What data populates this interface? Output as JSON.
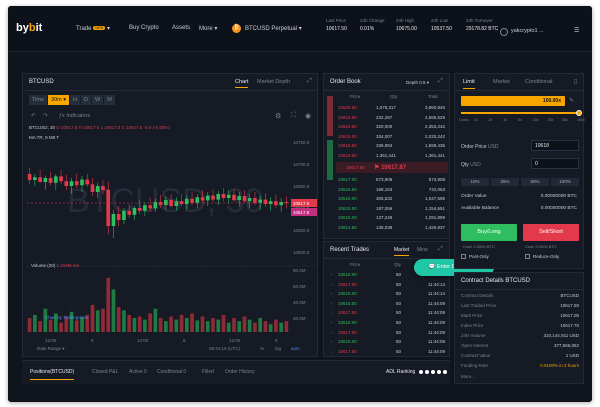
{
  "topbar": {
    "logo_prefix": "by",
    "logo_mid": "b",
    "logo_suffix": "it",
    "nav": [
      {
        "label": "Trade",
        "badge": "NEW"
      },
      {
        "label": "Buy Crypto"
      },
      {
        "label": "Assets"
      },
      {
        "label": "More"
      }
    ],
    "symbol": "BTCUSD Perpetual",
    "stats": [
      {
        "label": "Last Price",
        "value": "10617.50"
      },
      {
        "label": "24h Change",
        "value": "0.01%"
      },
      {
        "label": "24h High",
        "value": "10675.00"
      },
      {
        "label": "24h Low",
        "value": "10537.50"
      },
      {
        "label": "24h Turnover",
        "value": "29178.82 BTC"
      }
    ],
    "deposit": "Deposit",
    "username": "yakcrypto1 ..."
  },
  "chart_panel": {
    "title": "BTCUSD",
    "tab_chart": "Chart",
    "tab_depth": "Market Depth",
    "timeframes": [
      "Time",
      "30m",
      "H",
      "D",
      "W",
      "M"
    ],
    "indicators": "Indicators",
    "ohlc_label": "BTCUSD, 30",
    "ohlc_values": "O 10617.5  H 10617.5  L 10617.5  C 10617.5  -8.5 (-0.08%)",
    "ma_label": "MA TR, 9 M8 T",
    "watermark": "BTCUSD, 30",
    "volume_label": "Volume (20)",
    "volume_value": "1.319M  n/a",
    "credit": "Chart by TradingView",
    "x_ticks": [
      "12:00",
      "9",
      "12:00",
      "8",
      "12:00",
      "9"
    ],
    "y_ticks": [
      "10750.0",
      "10700.0",
      "10650.0",
      "10600.0",
      "10550.0",
      "10500.0"
    ],
    "price_tag": "10617.5",
    "price_tag2": "10617.5",
    "vol_ticks": [
      "80.0M",
      "60.0M",
      "40.0M",
      "20.0M"
    ],
    "date_range": "Date Range",
    "clock": "06:44:19 (UTC)",
    "pct": "%",
    "log": "log",
    "auto": "auto"
  },
  "orderbook": {
    "title": "Order Book",
    "depth": "Depth 0.5",
    "headers": [
      "Price",
      "Qty",
      "Total"
    ],
    "asks": [
      {
        "price": "10620.50",
        "qty": "1,075,317",
        "total": "3,860,946"
      },
      {
        "price": "10619.00",
        "qty": "232,287",
        "total": "2,585,529"
      },
      {
        "price": "10619.50",
        "qty": "320,000",
        "total": "2,353,242"
      },
      {
        "price": "10619.00",
        "qty": "334,007",
        "total": "2,033,242"
      },
      {
        "price": "10618.50",
        "qty": "336,994",
        "total": "1,699,435"
      },
      {
        "price": "10618.00",
        "qty": "1,361,441",
        "total": "1,361,441"
      }
    ],
    "mid_price": "10617.87",
    "mid_left": "10617.50",
    "bids": [
      {
        "price": "10617.00",
        "qty": "573,908",
        "total": "573,908"
      },
      {
        "price": "10616.50",
        "qty": "168,163",
        "total": "742,063"
      },
      {
        "price": "10616.00",
        "qty": "305,532",
        "total": "1,047,595"
      },
      {
        "price": "10615.50",
        "qty": "187,056",
        "total": "1,154,651"
      },
      {
        "price": "10615.00",
        "qty": "137,248",
        "total": "1,291,899"
      },
      {
        "price": "10614.50",
        "qty": "138,038",
        "total": "1,429,937"
      }
    ]
  },
  "recent_trades": {
    "title": "Recent Trades",
    "tab_market": "Market",
    "tab_mine": "Mine",
    "headers": [
      "Price",
      "Qty",
      "Time"
    ],
    "rows": [
      {
        "price": "10618.00",
        "qty": "50",
        "time": "11:44:14",
        "side": "buy"
      },
      {
        "price": "10617.50",
        "qty": "50",
        "time": "11:44:14",
        "side": "sell"
      },
      {
        "price": "10618.00",
        "qty": "50",
        "time": "11:44:14",
        "side": "buy"
      },
      {
        "price": "10618.00",
        "qty": "50",
        "time": "11:44:09",
        "side": "buy"
      },
      {
        "price": "10617.50",
        "qty": "50",
        "time": "11:44:09",
        "side": "sell"
      },
      {
        "price": "10618.00",
        "qty": "50",
        "time": "11:44:09",
        "side": "buy"
      },
      {
        "price": "10617.50",
        "qty": "50",
        "time": "11:44:09",
        "side": "sell"
      },
      {
        "price": "10618.00",
        "qty": "50",
        "time": "11:44:09",
        "side": "buy"
      },
      {
        "price": "10617.50",
        "qty": "50",
        "time": "11:44:09",
        "side": "sell"
      }
    ],
    "chat_button": "Enter Chat Room"
  },
  "order_panel": {
    "tab_limit": "Limit",
    "tab_market": "Market",
    "tab_conditional": "Conditional",
    "leverage": "100.00x",
    "lev_ticks": [
      "Cross",
      "1x",
      "2x",
      "3x",
      "5x",
      "10x",
      "25x",
      "50x",
      "100x"
    ],
    "order_price_label": "Order Price",
    "order_price_unit": "USD",
    "order_price_value": "10618",
    "qty_label": "Qty",
    "qty_unit": "USD",
    "qty_value": "0",
    "pcts": [
      "10%",
      "25%",
      "50%",
      "100%"
    ],
    "order_value_label": "Order Value",
    "order_value": "0.00000000 BTC",
    "avail_label": "Available Balance",
    "avail_value": "0.00000000 BTC",
    "buy_label": "Buy/Long",
    "buy_cost": "Cost: 0.0000 BTC",
    "sell_label": "Sell/Short",
    "sell_cost": "Cost: 0.0000 BTC",
    "post_only": "Post-Only",
    "reduce_only": "Reduce-Only",
    "tif": "Good-Till-Cancelled"
  },
  "contract": {
    "title": "Contract Details BTCUSD",
    "rows": [
      {
        "label": "Contract Details",
        "value": "BTCUSD"
      },
      {
        "label": "Last Traded Price",
        "value": "10617.50"
      },
      {
        "label": "Mark Price",
        "value": "10617.00"
      },
      {
        "label": "Index Price",
        "value": "10617.70"
      },
      {
        "label": "24H Volume",
        "value": "310,144,911 USD"
      },
      {
        "label": "Open Interest",
        "value": "377,566,062"
      },
      {
        "label": "Contract Value",
        "value": "1 USD"
      },
      {
        "label": "Funding Rate",
        "value": "0.0100% in 2 hours"
      }
    ],
    "more": "More..."
  },
  "positions": {
    "tabs": [
      "Positions(BTCUSD)",
      "Closed P&L",
      "Active 0",
      "Conditional 0",
      "Filled",
      "Order History"
    ],
    "adl": "ADL Ranking"
  },
  "colors": {
    "accent": "#f7a600",
    "buy": "#2ebd5f",
    "sell": "#e2394c",
    "bg": "#10141d",
    "panel": "#151a24"
  },
  "chart_data": {
    "type": "candlestick",
    "candles": [
      [
        10690,
        10705,
        10665,
        10675
      ],
      [
        10675,
        10690,
        10660,
        10682
      ],
      [
        10682,
        10700,
        10668,
        10670
      ],
      [
        10670,
        10686,
        10650,
        10680
      ],
      [
        10680,
        10695,
        10662,
        10668
      ],
      [
        10668,
        10690,
        10650,
        10684
      ],
      [
        10684,
        10700,
        10665,
        10672
      ],
      [
        10672,
        10688,
        10650,
        10660
      ],
      [
        10660,
        10680,
        10640,
        10672
      ],
      [
        10672,
        10690,
        10655,
        10662
      ],
      [
        10662,
        10685,
        10645,
        10676
      ],
      [
        10676,
        10690,
        10658,
        10664
      ],
      [
        10664,
        10680,
        10635,
        10645
      ],
      [
        10645,
        10668,
        10630,
        10660
      ],
      [
        10660,
        10675,
        10640,
        10650
      ],
      [
        10650,
        10670,
        10540,
        10560
      ],
      [
        10560,
        10600,
        10530,
        10590
      ],
      [
        10590,
        10610,
        10560,
        10575
      ],
      [
        10575,
        10605,
        10565,
        10598
      ],
      [
        10598,
        10615,
        10580,
        10588
      ],
      [
        10588,
        10610,
        10575,
        10605
      ],
      [
        10605,
        10625,
        10590,
        10598
      ],
      [
        10598,
        10620,
        10585,
        10612
      ],
      [
        10612,
        10630,
        10596,
        10604
      ],
      [
        10604,
        10628,
        10595,
        10620
      ],
      [
        10620,
        10638,
        10605,
        10612
      ],
      [
        10612,
        10634,
        10600,
        10625
      ],
      [
        10625,
        10640,
        10606,
        10610
      ],
      [
        10610,
        10632,
        10598,
        10622
      ],
      [
        10622,
        10640,
        10610,
        10615
      ],
      [
        10615,
        10636,
        10602,
        10628
      ],
      [
        10628,
        10645,
        10612,
        10618
      ],
      [
        10618,
        10640,
        10604,
        10632
      ],
      [
        10632,
        10650,
        10618,
        10624
      ],
      [
        10624,
        10645,
        10610,
        10636
      ],
      [
        10636,
        10652,
        10620,
        10626
      ],
      [
        10626,
        10648,
        10612,
        10640
      ],
      [
        10640,
        10655,
        10622,
        10630
      ],
      [
        10630,
        10650,
        10615,
        10638
      ],
      [
        10638,
        10652,
        10620,
        10625
      ],
      [
        10625,
        10645,
        10608,
        10635
      ],
      [
        10635,
        10650,
        10618,
        10622
      ],
      [
        10622,
        10640,
        10605,
        10630
      ],
      [
        10630,
        10645,
        10612,
        10618
      ],
      [
        10618,
        10635,
        10600,
        10626
      ],
      [
        10626,
        10642,
        10608,
        10615
      ],
      [
        10615,
        10632,
        10598,
        10622
      ],
      [
        10622,
        10638,
        10606,
        10612
      ],
      [
        10612,
        10630,
        10596,
        10620
      ],
      [
        10620,
        10634,
        10604,
        10617.5
      ]
    ],
    "volumes": [
      18,
      22,
      14,
      30,
      16,
      24,
      12,
      20,
      26,
      15,
      19,
      22,
      35,
      28,
      30,
      70,
      55,
      32,
      28,
      22,
      18,
      20,
      16,
      24,
      30,
      18,
      14,
      20,
      16,
      22,
      18,
      24,
      15,
      20,
      14,
      18,
      16,
      22,
      12,
      18,
      14,
      20,
      16,
      12,
      18,
      14,
      10,
      16,
      12,
      14
    ],
    "ylim": [
      10490,
      10770
    ]
  }
}
